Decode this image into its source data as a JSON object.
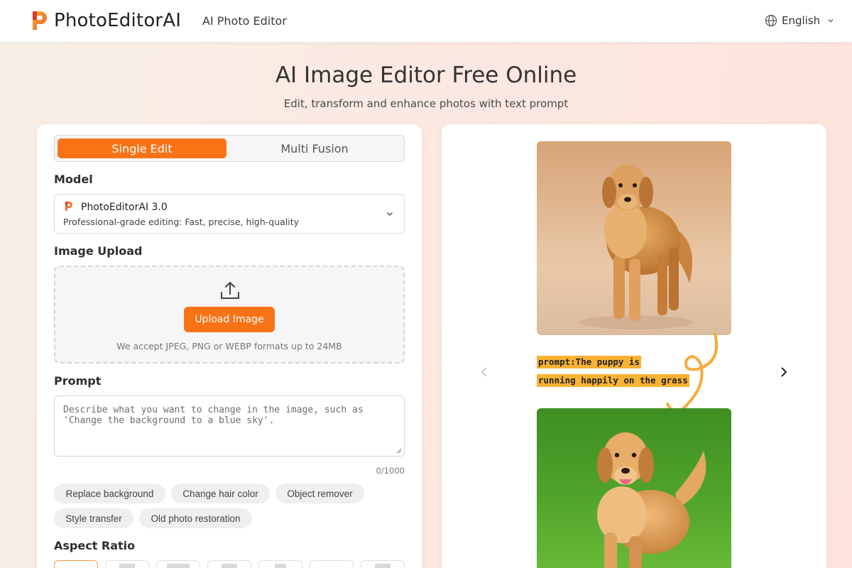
{
  "header": {
    "brand": "PhotoEditorAI",
    "nav_link": "AI Photo Editor",
    "language": "English"
  },
  "hero": {
    "title": "AI Image Editor Free Online",
    "subtitle": "Edit, transform and enhance photos with text prompt"
  },
  "editor": {
    "tabs": [
      {
        "label": "Single Edit",
        "active": true
      },
      {
        "label": "Multi Fusion",
        "active": false
      }
    ],
    "model_label": "Model",
    "model": {
      "name": "PhotoEditorAI 3.0",
      "description": "Professional-grade editing: Fast, precise, high-quality"
    },
    "upload_label": "Image Upload",
    "upload_button": "Upload Image",
    "upload_note": "We accept JPEG, PNG or WEBP formats up to 24MB",
    "prompt_label": "Prompt",
    "prompt_placeholder": "Describe what you want to change in the image, such as 'Change the background to a blue sky'.",
    "prompt_value": "",
    "counter": "0/1000",
    "suggestions": [
      "Replace background",
      "Change hair color",
      "Object remover",
      "Style transfer",
      "Old photo restoration"
    ],
    "aspect_ratio_label": "Aspect Ratio"
  },
  "demo": {
    "prompt_line1": "prompt:The puppy is",
    "prompt_line2": "running happily on the grass"
  },
  "colors": {
    "accent": "#f97316",
    "prompt_highlight": "#f9b233"
  }
}
